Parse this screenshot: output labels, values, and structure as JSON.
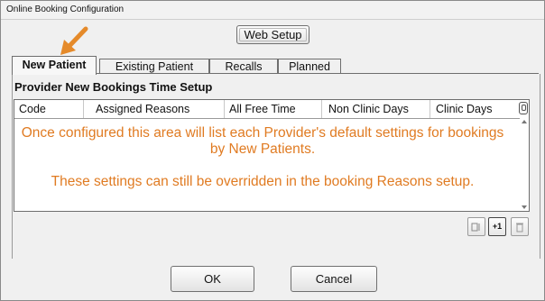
{
  "window": {
    "title": "Online Booking Configuration"
  },
  "toolbar": {
    "web_setup_label": "Web Setup"
  },
  "tabs": [
    {
      "label": "New Patient",
      "active": true
    },
    {
      "label": "Existing Patient",
      "active": false
    },
    {
      "label": "Recalls",
      "active": false
    },
    {
      "label": "Planned",
      "active": false
    }
  ],
  "section": {
    "title": "Provider New Bookings Time Setup"
  },
  "grid": {
    "columns": [
      "Code",
      "Assigned Reasons",
      "All Free Time",
      "Non Clinic Days",
      "Clinic Days"
    ],
    "rows": []
  },
  "overlay": {
    "line1": "Once configured this area will list each Provider's default settings for bookings by New Patients.",
    "line2": "These settings can still be overridden in the booking Reasons setup."
  },
  "grid_actions": {
    "plus_one_label": "+1"
  },
  "footer": {
    "ok_label": "OK",
    "cancel_label": "Cancel"
  },
  "colors": {
    "annotation": "#e07b22",
    "arrow": "#e58a2a"
  },
  "icons": [
    "orange-arrow-icon",
    "column-chooser-icon",
    "scroll-up-icon",
    "scroll-down-icon",
    "copy-icon",
    "trash-icon"
  ]
}
